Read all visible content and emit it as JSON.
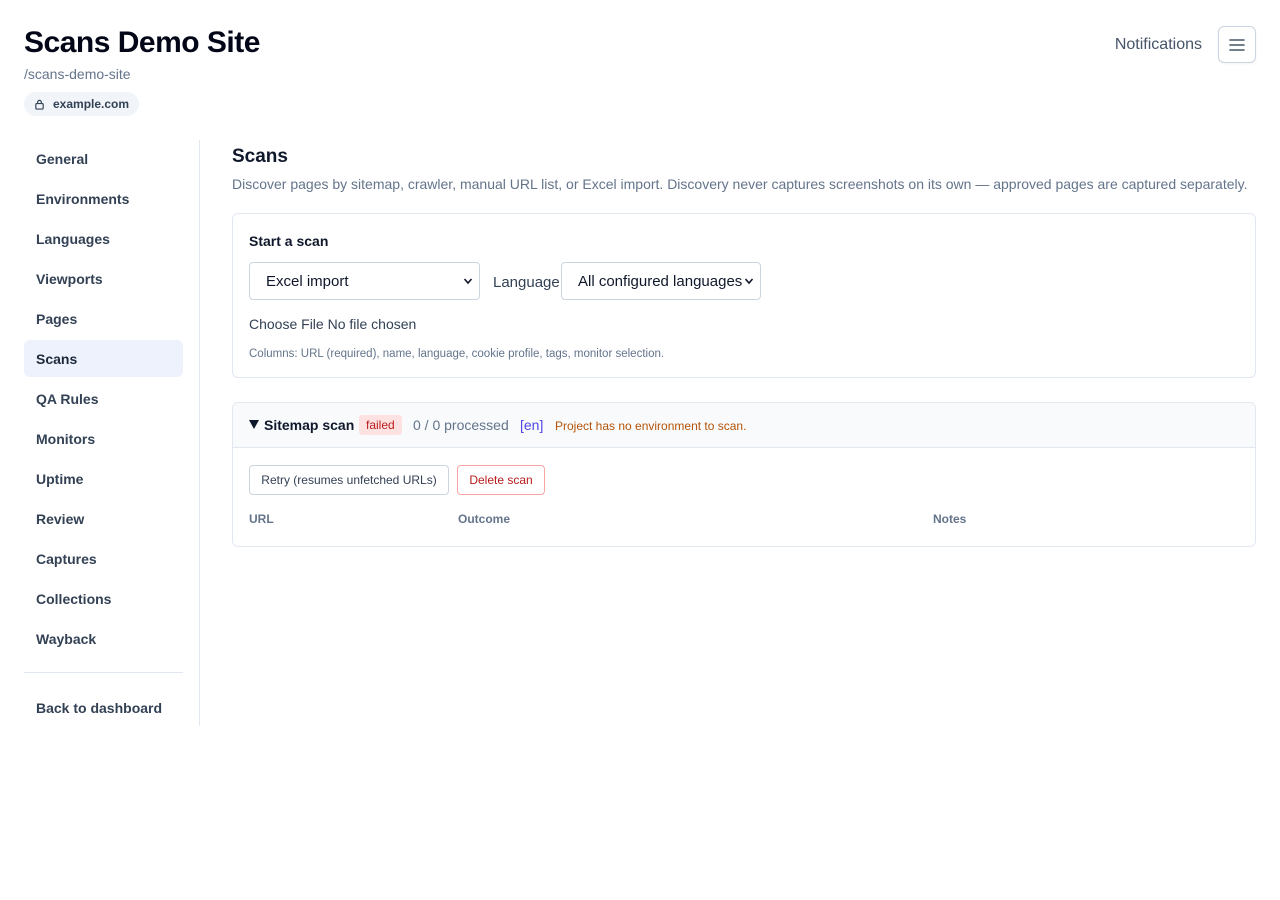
{
  "header": {
    "title": "Scans Demo Site",
    "slug": "/scans-demo-site",
    "domain": "example.com",
    "notifications_label": "Notifications",
    "lock_icon": "lock-icon",
    "menu_icon": "hamburger-menu-icon"
  },
  "sidebar": {
    "items": [
      {
        "label": "General"
      },
      {
        "label": "Environments"
      },
      {
        "label": "Languages"
      },
      {
        "label": "Viewports"
      },
      {
        "label": "Pages"
      },
      {
        "label": "Scans",
        "active": true
      },
      {
        "label": "QA Rules"
      },
      {
        "label": "Monitors"
      },
      {
        "label": "Uptime"
      },
      {
        "label": "Review"
      },
      {
        "label": "Captures"
      },
      {
        "label": "Collections"
      },
      {
        "label": "Wayback"
      }
    ],
    "back_label": "Back to dashboard"
  },
  "main": {
    "title": "Scans",
    "description": "Discover pages by sitemap, crawler, manual URL list, or Excel import. Discovery never captures screenshots on its own — approved pages are captured separately.",
    "start_scan": {
      "title": "Start a scan",
      "method_value": "Excel import",
      "language_label": "Language",
      "language_value": "All configured languages",
      "file_button": "Choose File",
      "file_status": "No file chosen",
      "columns_hint": "Columns: URL (required), name, language, cookie profile, tags, monitor selection."
    },
    "scan": {
      "name": "Sitemap scan",
      "status": "failed",
      "processed": "0 / 0 processed",
      "language": "[en]",
      "error": "Project has no environment to scan.",
      "retry_label": "Retry (resumes unfetched URLs)",
      "delete_label": "Delete scan",
      "columns": [
        "URL",
        "Outcome",
        "Notes"
      ]
    }
  },
  "colors": {
    "accent_active_bg": "#edf2fd",
    "error_badge_bg": "#fee2e2",
    "error_text": "#b91c1c",
    "warning_text": "#b45309",
    "lang_tag": "#4f46e5"
  }
}
